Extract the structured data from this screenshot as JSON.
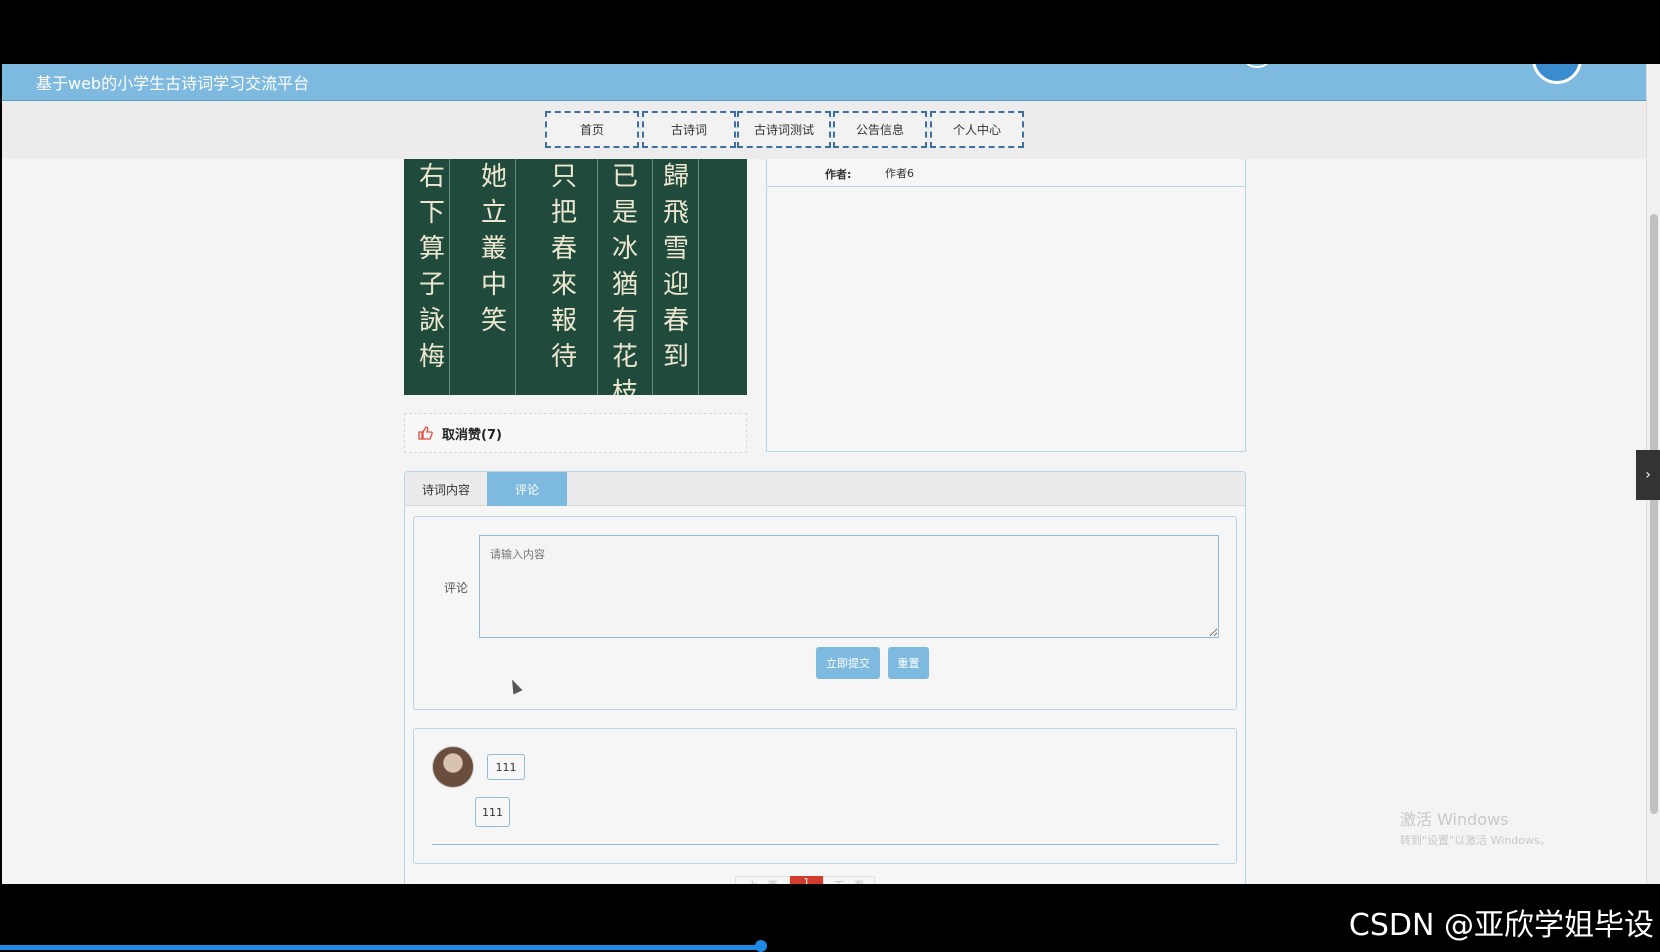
{
  "header": {
    "title": "基于web的小学生古诗词学习交流平台"
  },
  "nav": {
    "items": [
      {
        "label": "首页"
      },
      {
        "label": "古诗词"
      },
      {
        "label": "古诗词测试"
      },
      {
        "label": "公告信息"
      },
      {
        "label": "个人中心"
      }
    ]
  },
  "poem": {
    "image_icon": "calligraphy-image",
    "glyph_columns": [
      "右下算子詠梅",
      "她立叢中笑",
      "只把春來報待",
      "已是冰猶有花枝俏",
      "歸飛雪迎春到"
    ],
    "like_label": "取消赞(7)",
    "author_label": "作者:",
    "author_value": "作者6"
  },
  "tabs": {
    "content": "诗词内容",
    "comments": "评论"
  },
  "comment_form": {
    "label": "评论",
    "placeholder": "请输入内容",
    "submit": "立即提交",
    "reset": "重置"
  },
  "comments": [
    {
      "username": "111",
      "content": "111"
    }
  ],
  "pagination": {
    "prev": "上一页",
    "current": "1",
    "next": "下一页"
  },
  "overlay": {
    "watermark_line1": "激活 Windows",
    "watermark_line2": "转到\"设置\"以激活 Windows。",
    "csdn": "CSDN @亚欣学姐毕设"
  },
  "colors": {
    "accent": "#7ebadf",
    "danger": "#d43d2e"
  }
}
